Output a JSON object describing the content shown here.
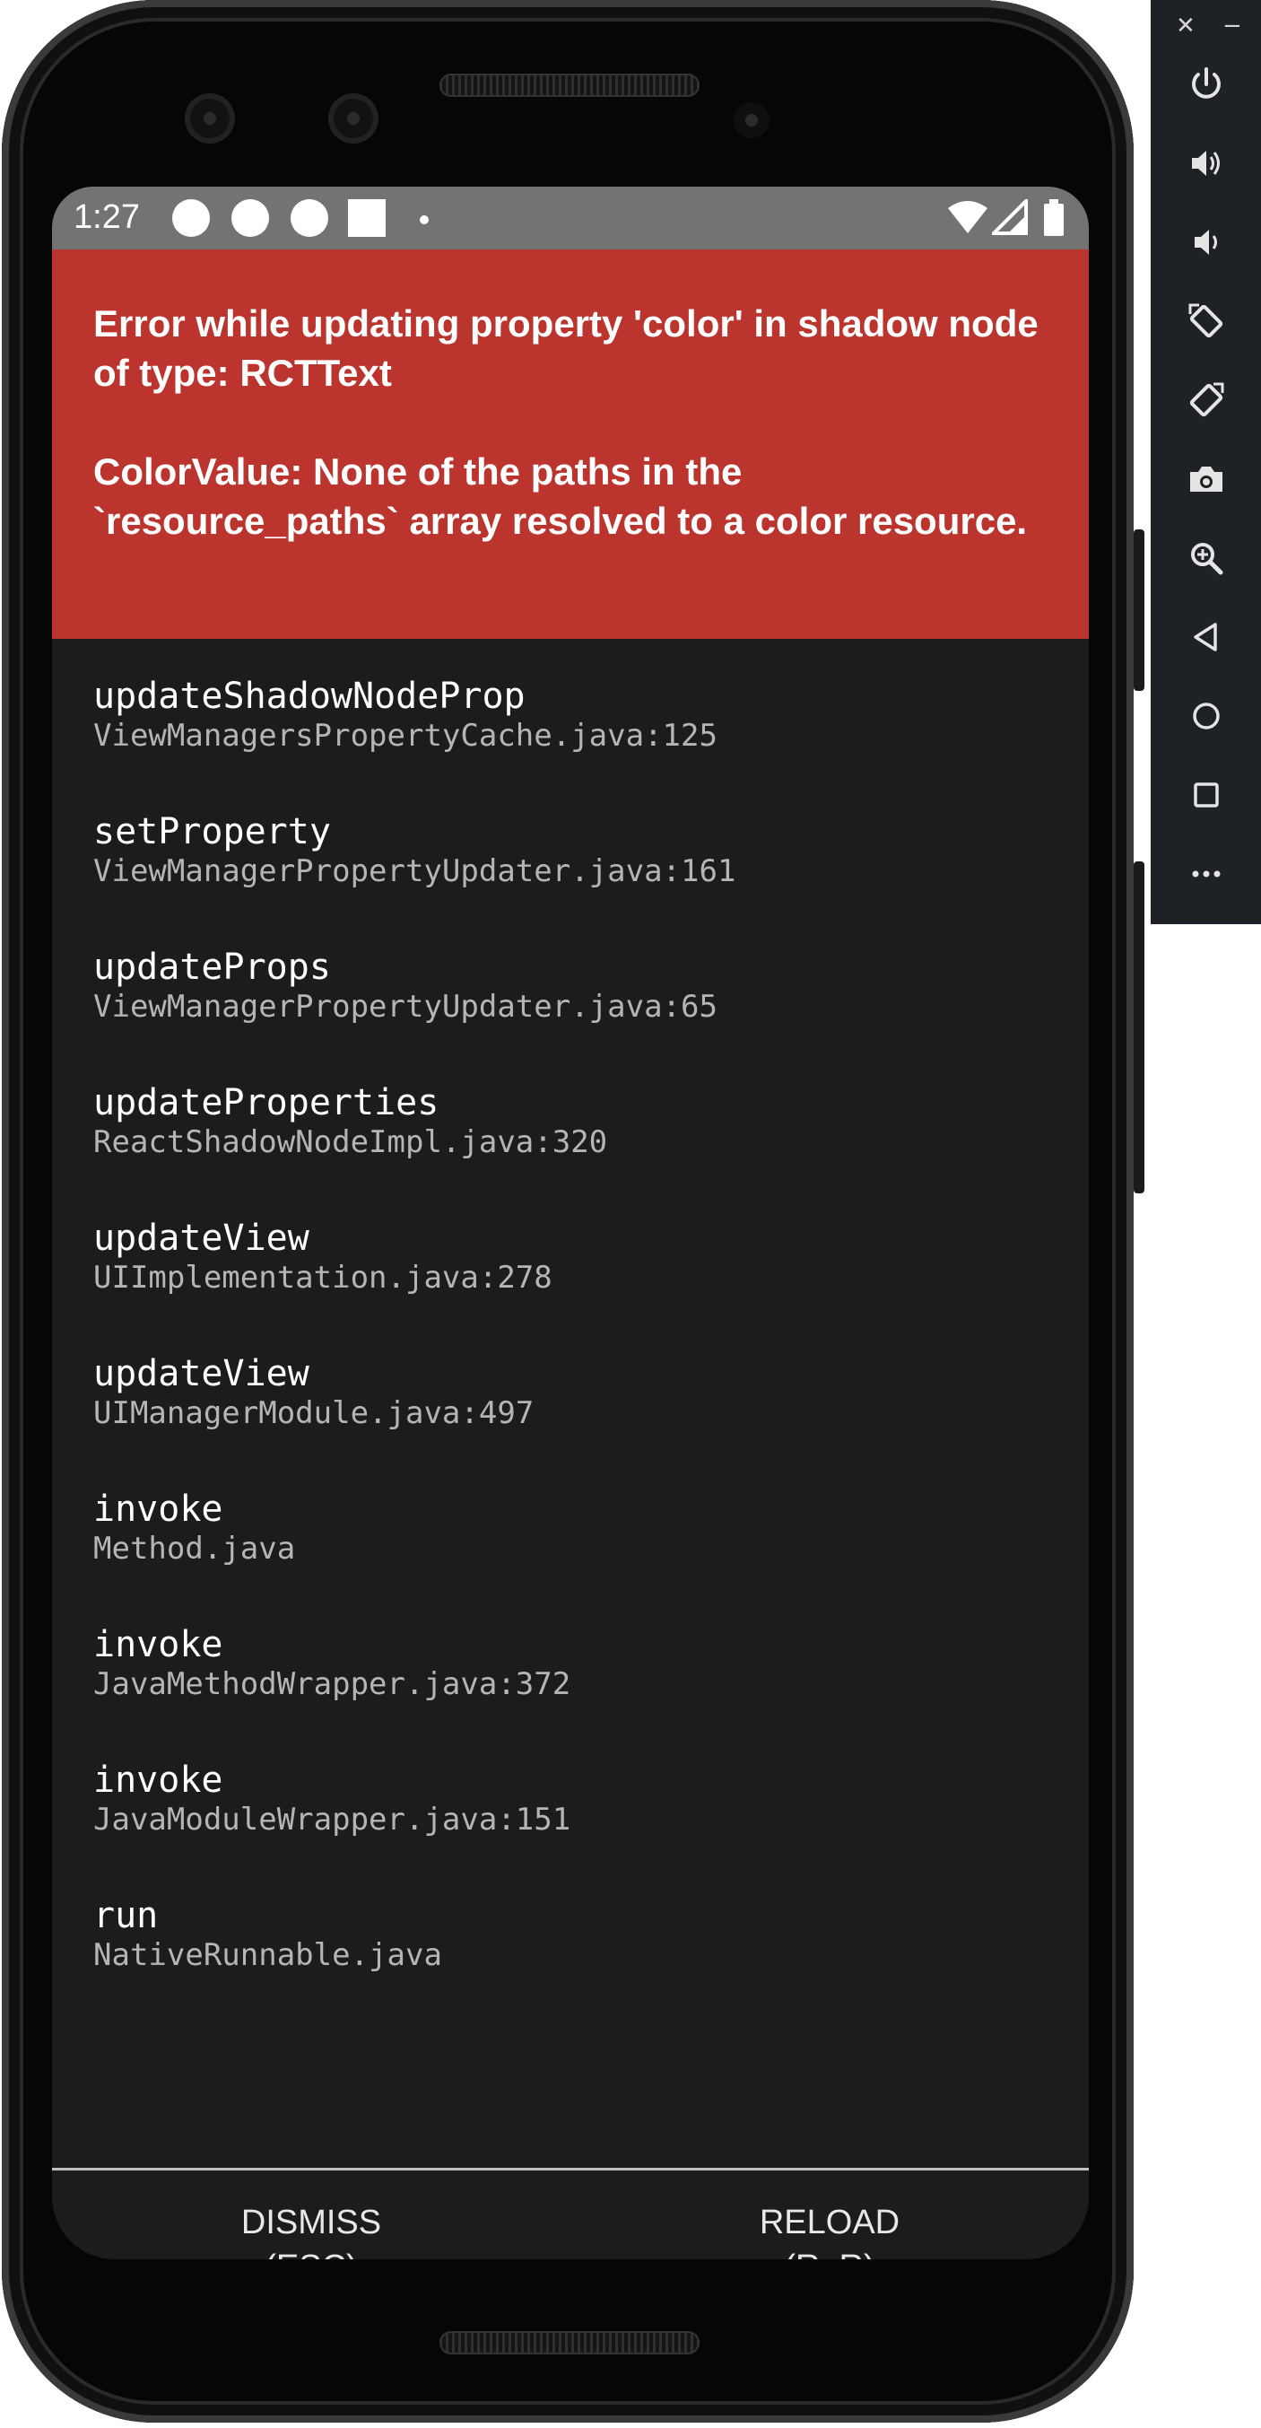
{
  "status_bar": {
    "time": "1:27"
  },
  "error": {
    "title": "Error while updating property 'color' in shadow node of type: RCTText",
    "message": "ColorValue: None of the paths in the `resource_paths` array resolved to a color resource."
  },
  "stack": [
    {
      "method": "updateShadowNodeProp",
      "file": "ViewManagersPropertyCache.java:125"
    },
    {
      "method": "setProperty",
      "file": "ViewManagerPropertyUpdater.java:161"
    },
    {
      "method": "updateProps",
      "file": "ViewManagerPropertyUpdater.java:65"
    },
    {
      "method": "updateProperties",
      "file": "ReactShadowNodeImpl.java:320"
    },
    {
      "method": "updateView",
      "file": "UIImplementation.java:278"
    },
    {
      "method": "updateView",
      "file": "UIManagerModule.java:497"
    },
    {
      "method": "invoke",
      "file": "Method.java"
    },
    {
      "method": "invoke",
      "file": "JavaMethodWrapper.java:372"
    },
    {
      "method": "invoke",
      "file": "JavaModuleWrapper.java:151"
    },
    {
      "method": "run",
      "file": "NativeRunnable.java"
    }
  ],
  "buttons": {
    "dismiss": {
      "line1": "DISMISS",
      "line2": "(ESC)"
    },
    "reload": {
      "line1": "RELOAD",
      "line2": "(R, R)"
    }
  },
  "nav": {
    "back": "back-triangle-icon",
    "home": "home-circle-icon",
    "recents": "recents-square-icon"
  },
  "emulator_toolbar": {
    "close": "✕",
    "minimize": "−",
    "items": [
      "power-icon",
      "volume-up-icon",
      "volume-down-icon",
      "rotate-left-icon",
      "rotate-right-icon",
      "camera-icon",
      "zoom-icon",
      "back-icon",
      "home-icon",
      "overview-icon",
      "more-icon"
    ]
  },
  "colors": {
    "error_red": "#bb342e",
    "screen_bg": "#1c1c1d",
    "status_bar_gray": "#737373",
    "toolbar_bg": "#1e2126"
  }
}
